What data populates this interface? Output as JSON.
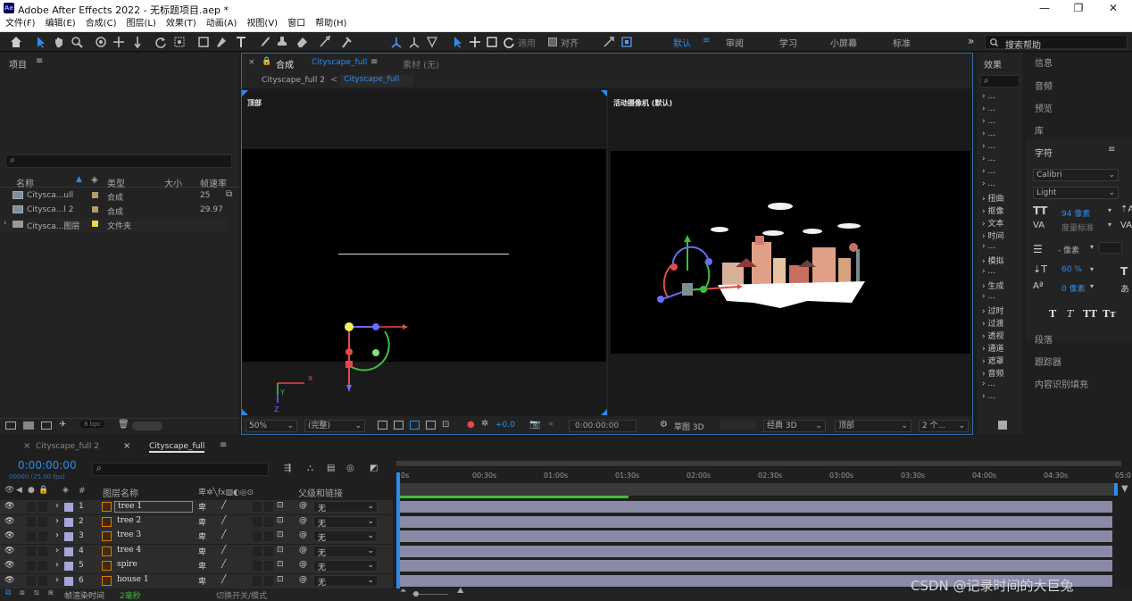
{
  "window": {
    "title": "Adobe After Effects 2022 - 无标题项目.aep *",
    "logo": "Ae",
    "min": "—",
    "max": "❐",
    "close": "✕"
  },
  "menu": [
    "文件(F)",
    "编辑(E)",
    "合成(C)",
    "图层(L)",
    "效果(T)",
    "动画(A)",
    "视图(V)",
    "窗口",
    "帮助(H)"
  ],
  "toolbar": {
    "snap_label": "对齐",
    "use_label": "適用",
    "workspaces": [
      "默认",
      "审阅",
      "学习",
      "小屏幕",
      "标准"
    ],
    "more": "»",
    "search_placeholder": "搜索帮助"
  },
  "project": {
    "title": "项目",
    "menu": "≡",
    "search_icon": "⌕",
    "columns": {
      "name": "名称",
      "type": "类型",
      "size": "大小",
      "fps": "帧速率"
    },
    "rows": [
      {
        "name": "Cityscа...ull",
        "type": "合成",
        "fps": "25",
        "color": "#b49a6e"
      },
      {
        "name": "Cityscа...l 2",
        "type": "合成",
        "fps": "29.97",
        "color": "#b49a6e"
      },
      {
        "name": "Citysca...图层",
        "type": "文件夹",
        "fps": "",
        "color": "#e6d84c"
      }
    ],
    "bpc": "8 bpc"
  },
  "comp": {
    "close": "×",
    "lock": "🔓",
    "label": "合成",
    "name": "Cityscape_full",
    "menu": "≡",
    "footage_label": "素材 (无)",
    "crumb1": "Cityscape_full 2",
    "crumb_sep": "<",
    "crumb2": "Cityscape_full",
    "view_left": "顶部",
    "view_right": "活动摄像机 (默认)",
    "footer": {
      "zoom": "50%",
      "res": "(完整)",
      "exposure": "+0.0",
      "time": "0:00:00:00",
      "renderer_label": "草图 3D",
      "renderer": "经典 3D",
      "view": "顶部",
      "views": "2 个..."
    }
  },
  "effects": {
    "title": "效果",
    "items": [
      "...",
      "...",
      "...",
      "...",
      "...",
      "...",
      "...",
      "...",
      "扭曲",
      "抠像",
      "文本",
      "时间",
      "...",
      "模拟",
      "...",
      "生成",
      "...",
      "过时",
      "过渡",
      "透视",
      "通道",
      "遮罩",
      "音频",
      "...",
      "..."
    ]
  },
  "right_panels": {
    "items": [
      "信息",
      "音频",
      "预览",
      "库"
    ],
    "char_title": "字符",
    "char_menu": "≡",
    "font": "Calibri",
    "style": "Light",
    "size": "94 像素",
    "leading": "- 像素",
    "stroke": "- 像素",
    "scale": "60 %",
    "baseline": "0 像素",
    "tracking_label": "度量标准",
    "text_buttons": [
      "T",
      "T",
      "TT",
      "Tт"
    ],
    "bottom_items": [
      "段落",
      "跟踪器",
      "内容识别填充"
    ]
  },
  "timeline": {
    "tabs": [
      "Cityscape_full 2",
      "Cityscape_full"
    ],
    "tab_close": "×",
    "time": "0:00:00:00",
    "fps_info": "00000 (25.00 fps)",
    "col_layer": "图层名称",
    "col_num": "#",
    "col_parent": "父级和链接",
    "layers": [
      {
        "num": "1",
        "name": "tree 1",
        "parent": "无"
      },
      {
        "num": "2",
        "name": "tree 2",
        "parent": "无"
      },
      {
        "num": "3",
        "name": "tree 3",
        "parent": "无"
      },
      {
        "num": "4",
        "name": "tree 4",
        "parent": "无"
      },
      {
        "num": "5",
        "name": "spire",
        "parent": "无"
      },
      {
        "num": "6",
        "name": "house 1",
        "parent": "无"
      }
    ],
    "ticks": [
      "0s",
      "00:30s",
      "01:00s",
      "01:30s",
      "02:00s",
      "02:30s",
      "03:00s",
      "03:30s",
      "04:00s",
      "04:30s",
      "05:0"
    ],
    "footer_render_label": "帧渲染时间",
    "footer_render_value": "2毫秒",
    "footer_toggle": "切换开关/模式"
  },
  "watermark": "CSDN @记录时间的大巨兔"
}
